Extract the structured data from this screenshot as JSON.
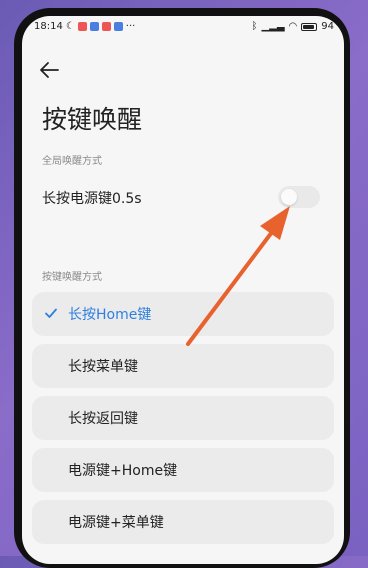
{
  "status_bar": {
    "time": "18:14",
    "battery": "94"
  },
  "header": {
    "title": "按键唤醒"
  },
  "global_section": {
    "label": "全局唤醒方式"
  },
  "power_key": {
    "label": "长按电源键0.5s",
    "enabled": false
  },
  "key_section": {
    "label": "按键唤醒方式"
  },
  "options": [
    {
      "label": "长按Home键",
      "selected": true
    },
    {
      "label": "长按菜单键",
      "selected": false
    },
    {
      "label": "长按返回键",
      "selected": false
    },
    {
      "label": "电源键+Home键",
      "selected": false
    },
    {
      "label": "电源键+菜单键",
      "selected": false
    }
  ],
  "colors": {
    "accent": "#2f7fe0",
    "annotation_arrow": "#e8622e"
  }
}
